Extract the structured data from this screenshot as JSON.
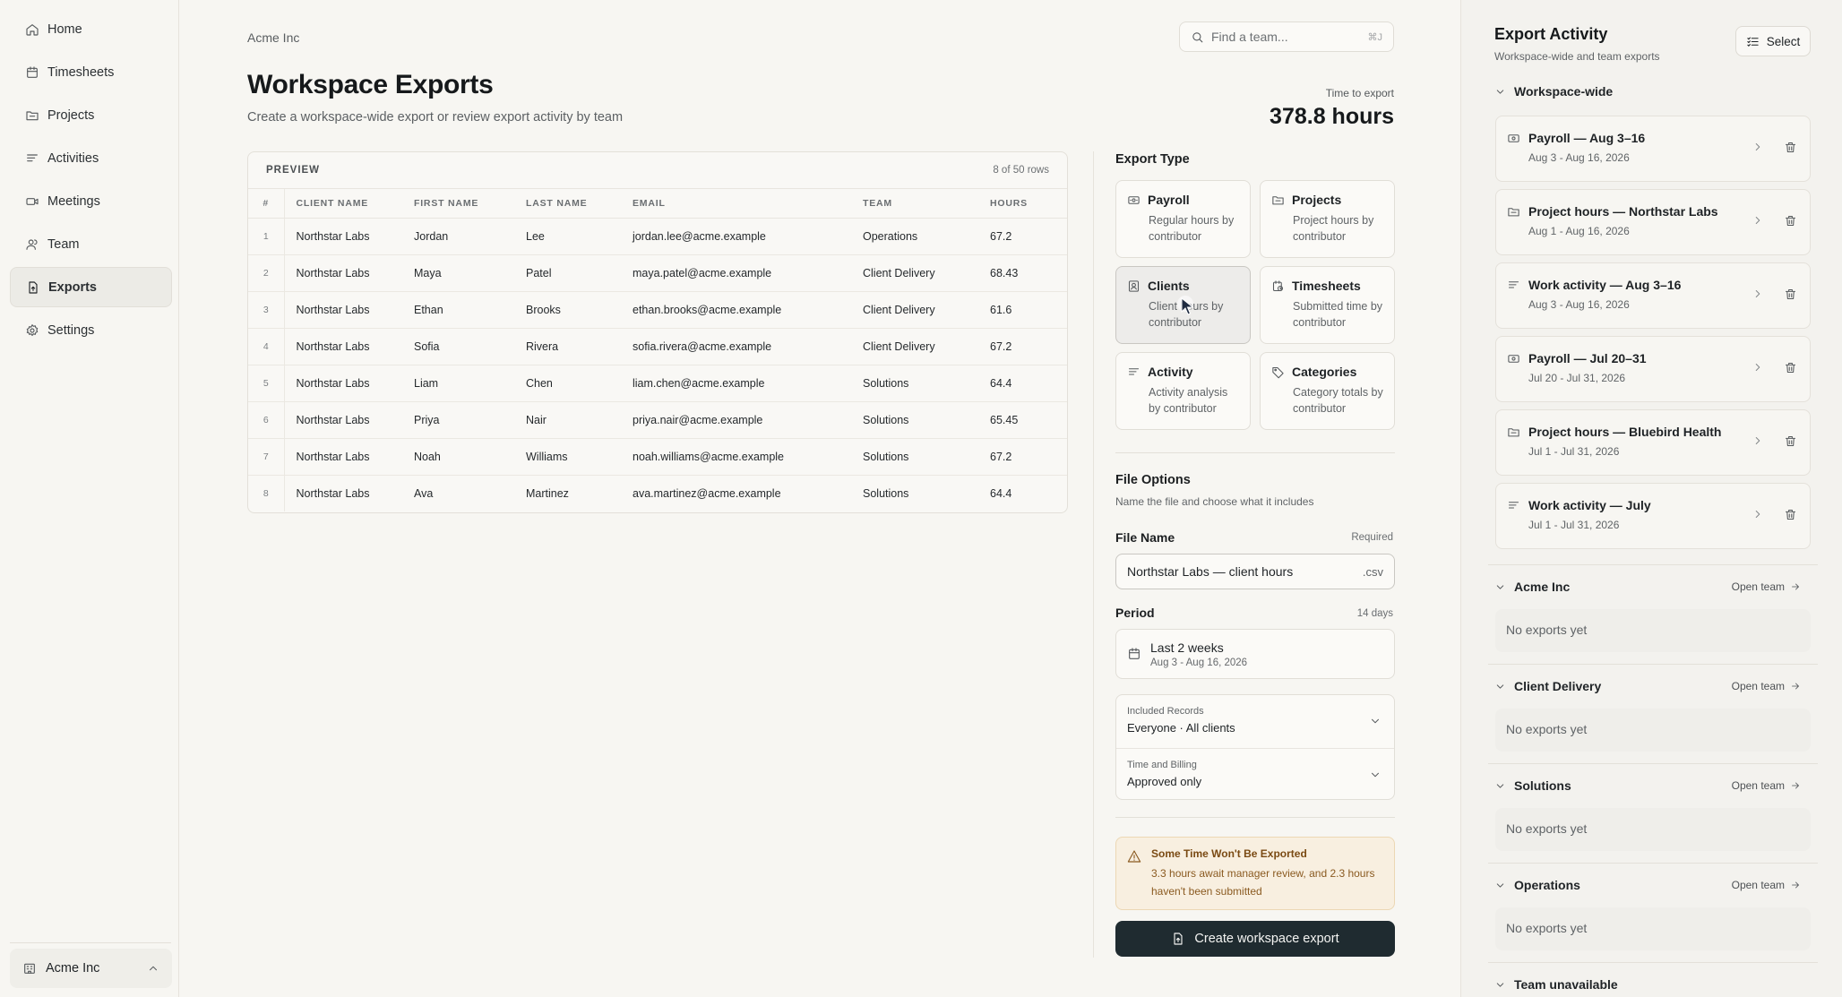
{
  "sidebar": {
    "items": [
      {
        "label": "Home",
        "icon": "home-icon"
      },
      {
        "label": "Timesheets",
        "icon": "calendar-icon"
      },
      {
        "label": "Projects",
        "icon": "folder-icon"
      },
      {
        "label": "Activities",
        "icon": "list-icon"
      },
      {
        "label": "Meetings",
        "icon": "video-icon"
      },
      {
        "label": "Team",
        "icon": "users-icon"
      },
      {
        "label": "Exports",
        "icon": "export-file-icon",
        "active": true
      },
      {
        "label": "Settings",
        "icon": "gear-icon"
      }
    ],
    "workspace": "Acme Inc"
  },
  "header": {
    "breadcrumb": "Acme Inc",
    "search_placeholder": "Find a team...",
    "search_shortcut": "⌘J",
    "title": "Workspace Exports",
    "subtitle": "Create a workspace-wide export or review export activity by team",
    "time_label": "Time to export",
    "time_value": "378.8 hours"
  },
  "preview": {
    "label": "PREVIEW",
    "count": "8 of 50 rows",
    "columns": [
      "#",
      "CLIENT NAME",
      "FIRST NAME",
      "LAST NAME",
      "EMAIL",
      "TEAM",
      "HOURS"
    ],
    "rows": [
      [
        "1",
        "Northstar Labs",
        "Jordan",
        "Lee",
        "jordan.lee@acme.example",
        "Operations",
        "67.2"
      ],
      [
        "2",
        "Northstar Labs",
        "Maya",
        "Patel",
        "maya.patel@acme.example",
        "Client Delivery",
        "68.43"
      ],
      [
        "3",
        "Northstar Labs",
        "Ethan",
        "Brooks",
        "ethan.brooks@acme.example",
        "Client Delivery",
        "61.6"
      ],
      [
        "4",
        "Northstar Labs",
        "Sofia",
        "Rivera",
        "sofia.rivera@acme.example",
        "Client Delivery",
        "67.2"
      ],
      [
        "5",
        "Northstar Labs",
        "Liam",
        "Chen",
        "liam.chen@acme.example",
        "Solutions",
        "64.4"
      ],
      [
        "6",
        "Northstar Labs",
        "Priya",
        "Nair",
        "priya.nair@acme.example",
        "Solutions",
        "65.45"
      ],
      [
        "7",
        "Northstar Labs",
        "Noah",
        "Williams",
        "noah.williams@acme.example",
        "Solutions",
        "67.2"
      ],
      [
        "8",
        "Northstar Labs",
        "Ava",
        "Martinez",
        "ava.martinez@acme.example",
        "Solutions",
        "64.4"
      ]
    ]
  },
  "export_type": {
    "title": "Export Type",
    "options": [
      {
        "name": "Payroll",
        "desc": "Regular hours by contributor",
        "icon": "payroll-icon"
      },
      {
        "name": "Projects",
        "desc": "Project hours by contributor",
        "icon": "folder-icon"
      },
      {
        "name": "Clients",
        "desc": "Client hours by contributor",
        "icon": "client-badge-icon",
        "selected": true
      },
      {
        "name": "Timesheets",
        "desc": "Submitted time by contributor",
        "icon": "timesheet-clock-icon"
      },
      {
        "name": "Activity",
        "desc": "Activity analysis by contributor",
        "icon": "list-icon"
      },
      {
        "name": "Categories",
        "desc": "Category totals by contributor",
        "icon": "tag-icon"
      }
    ]
  },
  "file_options": {
    "title": "File Options",
    "subtitle": "Name the file and choose what it includes",
    "file_name_label": "File Name",
    "file_name_required": "Required",
    "file_name_value": "Northstar Labs — client hours",
    "file_ext": ".csv",
    "period_label": "Period",
    "period_days": "14 days",
    "period_value": "Last 2 weeks",
    "period_range": "Aug 3 - Aug 16, 2026",
    "included_label": "Included Records",
    "included_value": "Everyone · All clients",
    "billing_label": "Time and Billing",
    "billing_value": "Approved only"
  },
  "warning": {
    "title": "Some Time Won't Be Exported",
    "text": "3.3 hours await manager review, and 2.3 hours haven't been submitted"
  },
  "create_button": "Create workspace export",
  "activity": {
    "title": "Export Activity",
    "subtitle": "Workspace-wide and team exports",
    "select_label": "Select",
    "workspace_group": "Workspace-wide",
    "exports": [
      {
        "name": "Payroll — Aug 3–16",
        "range": "Aug 3 - Aug 16, 2026",
        "icon": "payroll-icon"
      },
      {
        "name": "Project hours — Northstar Labs",
        "range": "Aug 1 - Aug 16, 2026",
        "icon": "folder-icon"
      },
      {
        "name": "Work activity — Aug 3–16",
        "range": "Aug 3 - Aug 16, 2026",
        "icon": "list-icon"
      },
      {
        "name": "Payroll — Jul 20–31",
        "range": "Jul 20 - Jul 31, 2026",
        "icon": "payroll-icon"
      },
      {
        "name": "Project hours — Bluebird Health",
        "range": "Jul 1 - Jul 31, 2026",
        "icon": "folder-icon"
      },
      {
        "name": "Work activity — July",
        "range": "Jul 1 - Jul 31, 2026",
        "icon": "list-icon"
      }
    ],
    "teams": [
      {
        "name": "Acme Inc",
        "link": "Open team",
        "empty": "No exports yet"
      },
      {
        "name": "Client Delivery",
        "link": "Open team",
        "empty": "No exports yet"
      },
      {
        "name": "Solutions",
        "link": "Open team",
        "empty": "No exports yet"
      },
      {
        "name": "Operations",
        "link": "Open team",
        "empty": "No exports yet"
      }
    ],
    "unavailable_group": "Team unavailable"
  }
}
